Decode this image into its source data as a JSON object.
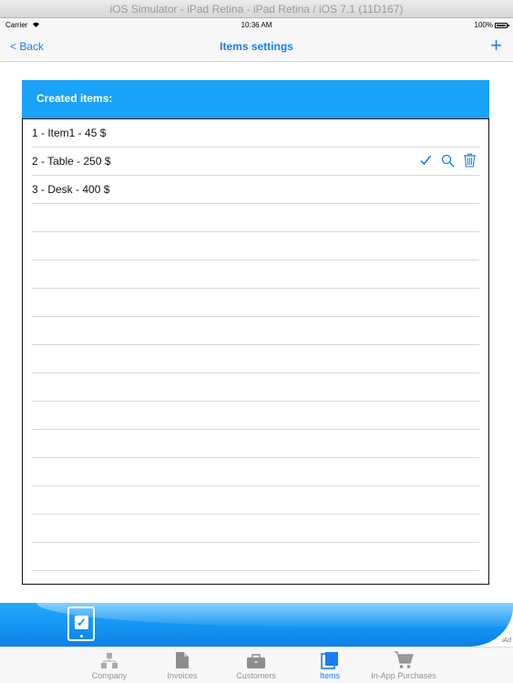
{
  "simulator": {
    "title": "iOS Simulator - iPad Retina - iPad Retina / iOS 7.1 (11D167)"
  },
  "statusbar": {
    "carrier": "Carrier",
    "time": "10:36 AM",
    "battery": "100%"
  },
  "navbar": {
    "back_label": "< Back",
    "title": "Items settings",
    "add_label": "+"
  },
  "panel": {
    "header": "Created items:",
    "items": [
      {
        "label": "1 - Item1 - 45 $"
      },
      {
        "label": "2 - Table - 250 $",
        "actions": [
          "checkmark-icon",
          "search-icon",
          "trash-icon"
        ]
      },
      {
        "label": "3 - Desk - 400 $"
      }
    ],
    "empty_rows": 13
  },
  "banner": {
    "ad_mark": "iAd"
  },
  "tabbar": {
    "tabs": [
      {
        "label": "Company",
        "icon": "company-icon",
        "active": false
      },
      {
        "label": "Invoices",
        "icon": "document-icon",
        "active": false
      },
      {
        "label": "Customers",
        "icon": "briefcase-icon",
        "active": false
      },
      {
        "label": "Items",
        "icon": "items-icon",
        "active": true
      },
      {
        "label": "In-App Purchases",
        "icon": "cart-icon",
        "active": false
      }
    ]
  },
  "colors": {
    "accent": "#1a7cf9",
    "header_bg": "#1aa3f8",
    "inactive_tab": "#929292"
  }
}
